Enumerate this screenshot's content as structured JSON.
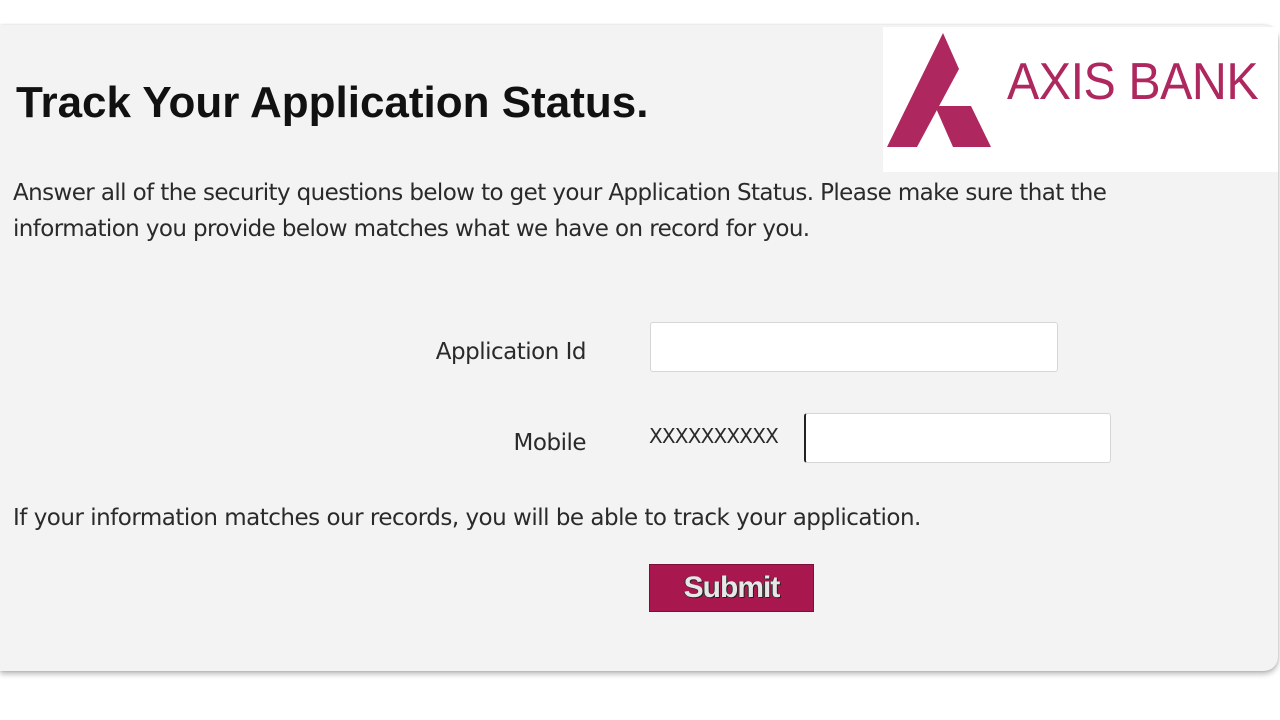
{
  "brand": {
    "name": "AXIS BANK",
    "color": "#ae275f"
  },
  "page": {
    "title": "Track Your Application Status.",
    "intro": "Answer all of the security questions below to get your Application Status. Please make sure that the information you provide below matches what we have on record for you.",
    "note": "If your information matches our records, you will be able to track your application."
  },
  "form": {
    "application_id": {
      "label": "Application Id",
      "value": "",
      "placeholder": ""
    },
    "mobile": {
      "label": "Mobile",
      "prefix": "XXXXXXXXXX",
      "value": "",
      "placeholder": ""
    },
    "submit_label": "Submit",
    "submit_color": "#a8184f"
  }
}
